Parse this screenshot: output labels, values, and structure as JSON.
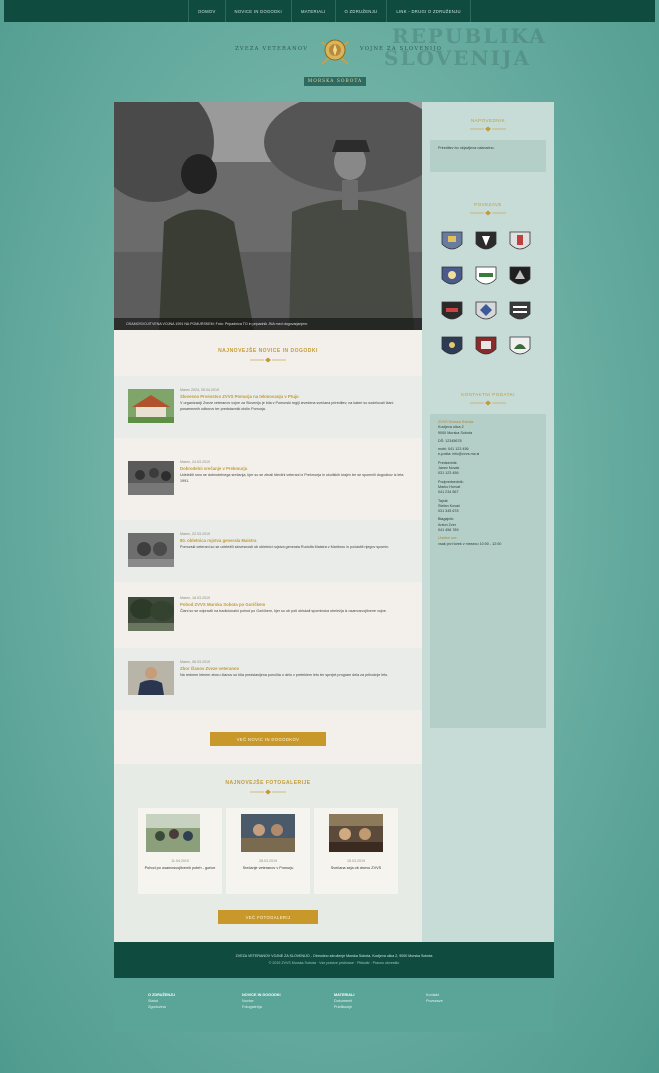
{
  "nav": {
    "items": [
      "DOMOV",
      "NOVICE IN DOGODKI",
      "MATERIALI",
      "O ZDRUŽENJU",
      "LINK - DRUGI O ZDRUŽENJU"
    ]
  },
  "header": {
    "org_name_left": "ZVEZA VETERANOV",
    "org_name_right": "VOJNE ZA SLOVENIJO",
    "subtitle": "MORSKA SOBOTA",
    "watermark_1": "REPUBLIKA",
    "watermark_2": "SLOVENIJA"
  },
  "hero": {
    "caption": "OSAMOSVOJITVENA VOJNA 1991 NA POMURSKEM: Foto: Pripadnica TO in pripadnik JNA med dogovarjanjem."
  },
  "news": {
    "title": "NAJNOVEJŠE NOVICE IN DOGODKI",
    "items": [
      {
        "date": "Marec 2024, 05.04.2019",
        "title": "Slovesno Prvenstvo ZVVS Pomurja na tekmovanju v Ptuju",
        "excerpt": "V organizaciji Zveze veteranov vojne za Slovenijo je bila v Pomurski regiji izvedena svečana prireditev, na kateri so sodelovali člani posameznih odborov ter predstavniki občin Pomurja."
      },
      {
        "date": "Marec, 24.03.2019",
        "title": "Dobrodelni srečanje v Prekmurju",
        "excerpt": "Udeležili smo se dobrodelnega srečanja, kjer so se zbrali številni veterani iz Prekmurja in okoliških krajev ter se spomnili dogodkov iz leta 1991."
      },
      {
        "date": "Marec, 22.03.2019",
        "title": "80. obletnica rojstva generala Maistra",
        "excerpt": "Pomurski veterani so se udeležili slovesnosti ob obletnici rojstva generala Rudolfa Maistra v Mariboru in počastili njegov spomin."
      },
      {
        "date": "Marec, 18.03.2019",
        "title": "Pohod ZVVS Murska Sobota po Goričkem",
        "excerpt": "Člani so se odpravili na tradicionalni pohod po Goričkem, kjer so ob poti obiskali spominska obeležja iz osamosvojitvene vojne."
      },
      {
        "date": "Marec, 06.03.2019",
        "title": "Zbor članov Zveze veteranov",
        "excerpt": "Na rednem letnem zboru članov so bila predstavljena poročila o delu v preteklem letu ter sprejet program dela za prihodnje leto."
      }
    ],
    "more_button": "VEČ NOVIC IN DOGODKOV"
  },
  "gallery": {
    "title": "NAJNOVEJŠE FOTOGALERIJE",
    "items": [
      {
        "date": "11.04.2019",
        "title": "Pohod po osamosvojitvenih poteh - gorice"
      },
      {
        "date": "28.03.2019",
        "title": "Srečanje veteranov v Pomurju"
      },
      {
        "date": "15.03.2019",
        "title": "Svečana seja ob dnevu ZVVS"
      }
    ],
    "more_button": "VEČ FOTOGALERIJ"
  },
  "sidebar": {
    "materials_title": "NAPOVEDNIK",
    "materials_text": "Prireditev bo objavljena naknadno.",
    "members_title": "POVEZAVE",
    "contact_title": "KONTAKTNI PODATKI",
    "contact_lines": [
      {
        "text": "ZVVS Murska Sobota",
        "gold": true
      },
      {
        "text": "Kocljeva ulica 2",
        "gold": false
      },
      {
        "text": "9000 Murska Sobota",
        "gold": false
      },
      {
        "text": "",
        "gold": false
      },
      {
        "text": "DŠ: 12345678",
        "gold": false
      },
      {
        "text": "",
        "gold": false
      },
      {
        "text": "mobi: 041 123 456",
        "gold": false
      },
      {
        "text": "e-pošta: info@zvvs-ms.si",
        "gold": false
      },
      {
        "text": "",
        "gold": false
      },
      {
        "text": "Predsednik:",
        "gold": false
      },
      {
        "text": "Janez Novak",
        "gold": false
      },
      {
        "text": "031 123 456",
        "gold": false
      },
      {
        "text": "",
        "gold": false
      },
      {
        "text": "Podpredsednik:",
        "gold": false
      },
      {
        "text": "Marko Horvat",
        "gold": false
      },
      {
        "text": "041 234 567",
        "gold": false
      },
      {
        "text": "",
        "gold": false
      },
      {
        "text": "Tajnik:",
        "gold": false
      },
      {
        "text": "Stefan Kovač",
        "gold": false
      },
      {
        "text": "031 345 678",
        "gold": false
      },
      {
        "text": "",
        "gold": false
      },
      {
        "text": "Blagajnik:",
        "gold": false
      },
      {
        "text": "Anton Zver",
        "gold": false
      },
      {
        "text": "041 456 789",
        "gold": false
      },
      {
        "text": "",
        "gold": false
      },
      {
        "text": "Uradne ure:",
        "gold": true
      },
      {
        "text": "vsak prvi torek v mesecu 10:00 - 12:00",
        "gold": false
      }
    ]
  },
  "footer": {
    "line1": "ZVEZA VETERANOV VOJNE ZA SLOVENIJO - Območno združenje Murska Sobota, Kocljeva ulica 2, 9000 Murska Sobota",
    "line2": "© 2019 ZVVS Murska Sobota · Vse pravice pridržane · Piškotki · Pravno obvestilo",
    "columns": [
      {
        "heading": "O ZDRUŽENJU",
        "links": [
          "Statut",
          "Zgodovina"
        ]
      },
      {
        "heading": "NOVICE IN DOGODKI",
        "links": [
          "Novice",
          "Fotogalerija"
        ]
      },
      {
        "heading": "MATERIALI",
        "links": [
          "Dokumenti",
          "Publikacije"
        ]
      },
      {
        "heading": "",
        "links": [
          "Kontakt",
          "Povezave"
        ]
      }
    ]
  },
  "colors": {
    "gold": "#c39a38",
    "dark_green": "#0f4b3f",
    "teal_bg": "#6cb0a4"
  }
}
